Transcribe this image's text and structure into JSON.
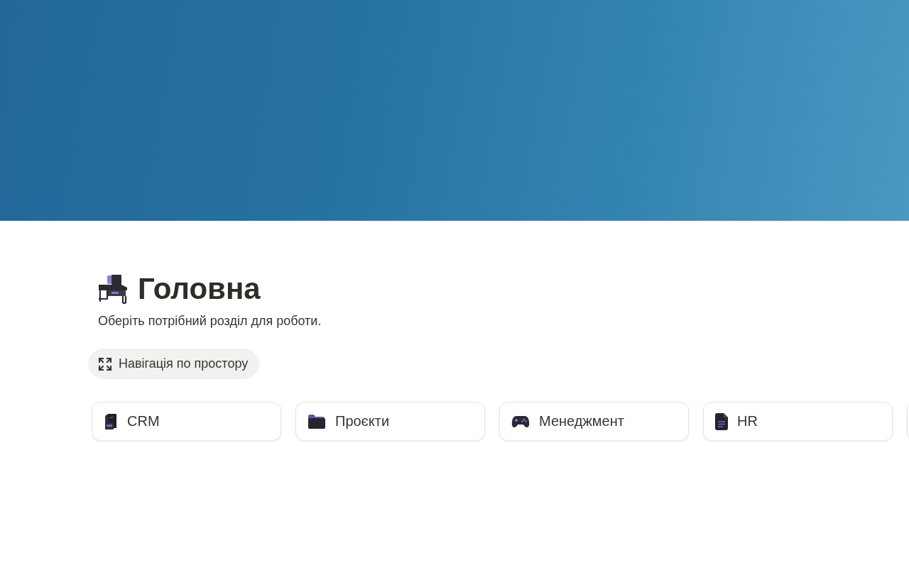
{
  "page": {
    "title": "Головна",
    "subtitle": "Оберіть потрібний розділ для роботи."
  },
  "navigation_button": {
    "label": "Навігація по простору"
  },
  "cards": [
    {
      "label": "CRM",
      "kind": "cabinet"
    },
    {
      "label": "Проєкти",
      "kind": "folder"
    },
    {
      "label": "Менеджмент",
      "kind": "gamepad"
    },
    {
      "label": "HR",
      "kind": "document"
    }
  ]
}
